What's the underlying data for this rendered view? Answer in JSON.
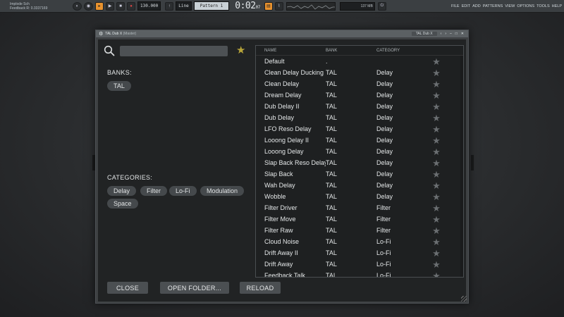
{
  "toolbar": {
    "hint_line1": "Implode Sch",
    "hint_line2": "Feedback R: 0.3337169",
    "tempo": "130.000",
    "snap": "Line",
    "pattern": "Pattern 1",
    "time_main": "0:02",
    "time_sub": "07",
    "cpu": "137 MB",
    "menu": [
      "FILE",
      "EDIT",
      "ADD",
      "PATTERNS",
      "VIEW",
      "OPTIONS",
      "TOOLS",
      "HELP"
    ]
  },
  "window": {
    "title": "TAL Dub X",
    "title_suffix": "(Master)",
    "preset_mini": "TAL Dub X"
  },
  "search": {
    "value": "",
    "placeholder": ""
  },
  "banks": {
    "label": "BANKS:",
    "items": [
      "TAL"
    ]
  },
  "categories": {
    "label": "CATEGORIES:",
    "items": [
      "Delay",
      "Filter",
      "Lo-Fi",
      "Modulation",
      "Space"
    ]
  },
  "table": {
    "headers": {
      "name": "NAME",
      "bank": "BANK",
      "category": "CATEGORY"
    },
    "rows": [
      {
        "name": "Default",
        "bank": ".",
        "category": ""
      },
      {
        "name": "Clean Delay Ducking",
        "bank": "TAL",
        "category": "Delay"
      },
      {
        "name": "Clean Delay",
        "bank": "TAL",
        "category": "Delay"
      },
      {
        "name": "Dream Delay",
        "bank": "TAL",
        "category": "Delay"
      },
      {
        "name": "Dub Delay II",
        "bank": "TAL",
        "category": "Delay"
      },
      {
        "name": "Dub Delay",
        "bank": "TAL",
        "category": "Delay"
      },
      {
        "name": "LFO Reso Delay",
        "bank": "TAL",
        "category": "Delay"
      },
      {
        "name": "Looong Delay II",
        "bank": "TAL",
        "category": "Delay"
      },
      {
        "name": "Looong Delay",
        "bank": "TAL",
        "category": "Delay"
      },
      {
        "name": "Slap Back Reso Delay",
        "bank": "TAL",
        "category": "Delay"
      },
      {
        "name": "Slap Back",
        "bank": "TAL",
        "category": "Delay"
      },
      {
        "name": "Wah Delay",
        "bank": "TAL",
        "category": "Delay"
      },
      {
        "name": "Wobble",
        "bank": "TAL",
        "category": "Delay"
      },
      {
        "name": "Filter Driver",
        "bank": "TAL",
        "category": "Filter"
      },
      {
        "name": "Filter Move",
        "bank": "TAL",
        "category": "Filter"
      },
      {
        "name": "Filter Raw",
        "bank": "TAL",
        "category": "Filter"
      },
      {
        "name": "Cloud Noise",
        "bank": "TAL",
        "category": "Lo-Fi"
      },
      {
        "name": "Drift Away II",
        "bank": "TAL",
        "category": "Lo-Fi"
      },
      {
        "name": "Drift Away",
        "bank": "TAL",
        "category": "Lo-Fi"
      },
      {
        "name": "Feedback Talk",
        "bank": "TAL",
        "category": "Lo-Fi"
      }
    ]
  },
  "buttons": {
    "close": "CLOSE",
    "open_folder": "OPEN FOLDER...",
    "reload": "RELOAD"
  },
  "colors": {
    "favorite_star": "#b8a53a",
    "row_star": "#6a6e71",
    "accent_orange": "#e8922e"
  }
}
